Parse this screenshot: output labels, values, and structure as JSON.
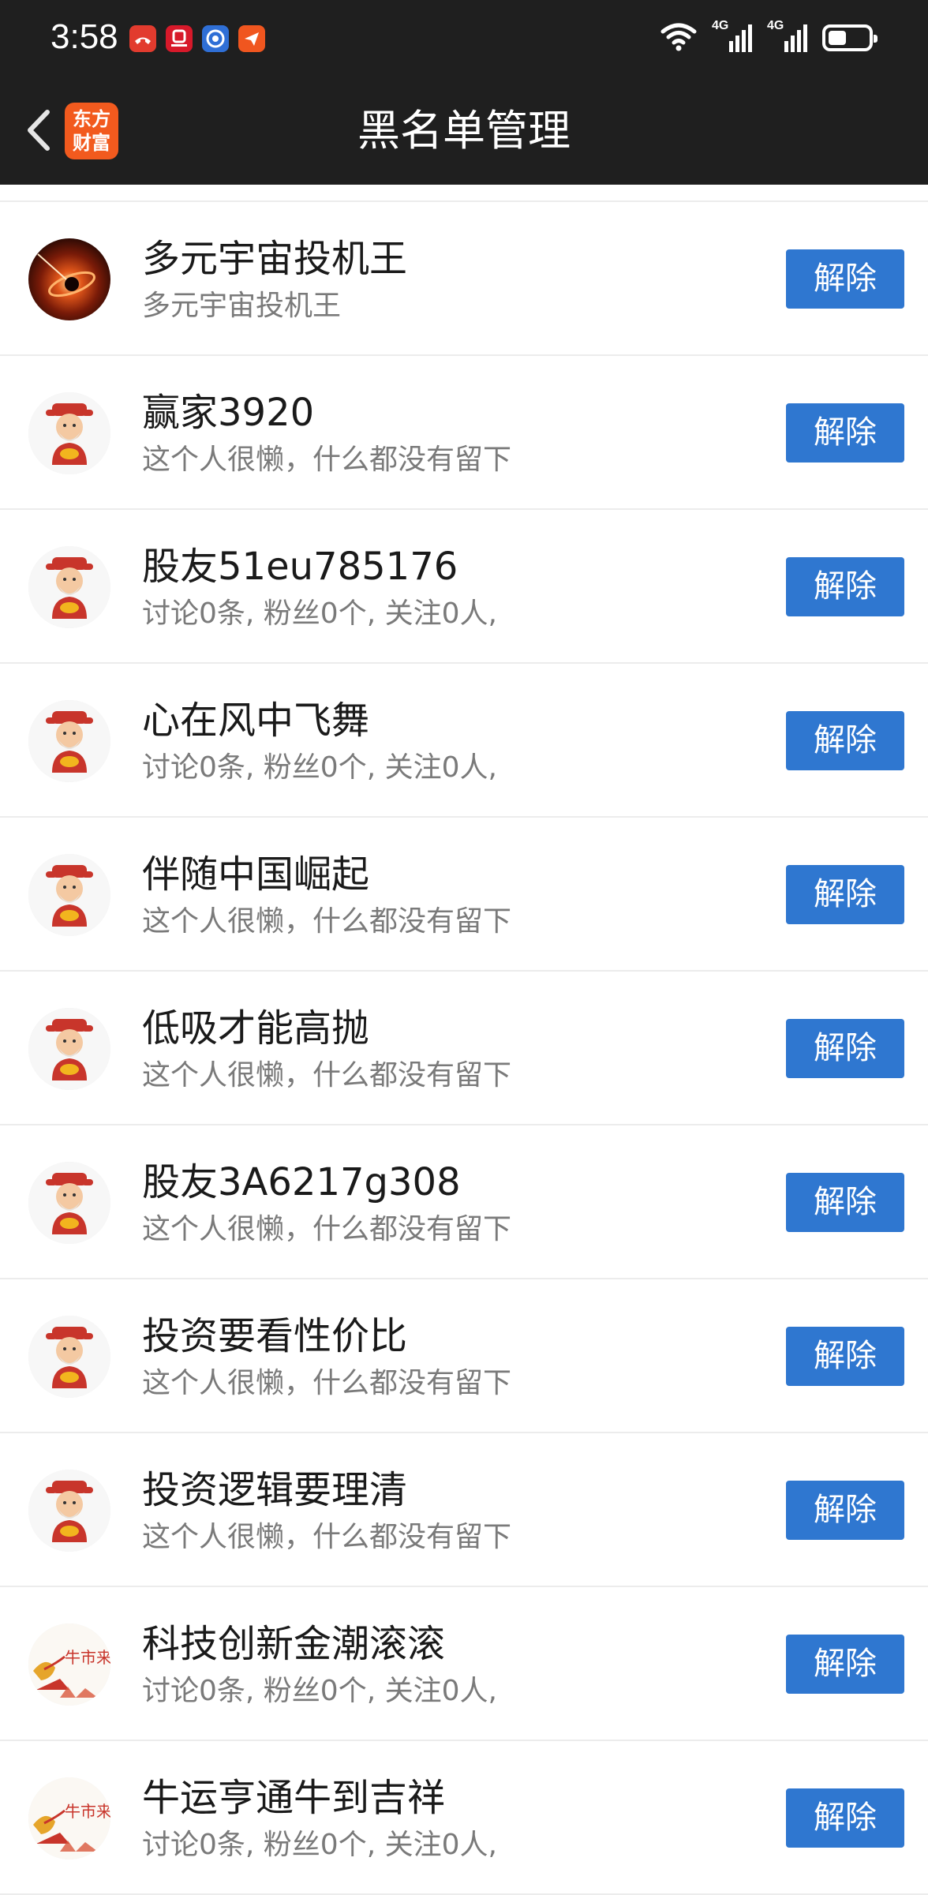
{
  "status_bar": {
    "time": "3:58",
    "network_1": "4G",
    "network_2": "4G",
    "battery_level": 0.45,
    "notification_icons": [
      "missed-call-icon",
      "securities-app-icon",
      "browser-app-icon",
      "messenger-app-icon"
    ]
  },
  "nav": {
    "title": "黑名单管理",
    "logo_line1": "东方",
    "logo_line2": "财富"
  },
  "colors": {
    "header_bg": "#1f1f1f",
    "button_bg": "#2f77d0",
    "logo_bg": "#f25a1e"
  },
  "list": {
    "button_label": "解除",
    "items": [
      {
        "name": "多元宇宙投机王",
        "subtitle": "多元宇宙投机王",
        "avatar": "galaxy-avatar"
      },
      {
        "name": "赢家3920",
        "subtitle": "这个人很懒，什么都没有留下",
        "avatar": "fortune-god-avatar"
      },
      {
        "name": "股友51eu785176",
        "subtitle": "讨论0条, 粉丝0个, 关注0人,",
        "avatar": "fortune-god-avatar"
      },
      {
        "name": "心在风中飞舞",
        "subtitle": "讨论0条, 粉丝0个, 关注0人,",
        "avatar": "fortune-god-avatar"
      },
      {
        "name": "伴随中国崛起",
        "subtitle": "这个人很懒，什么都没有留下",
        "avatar": "fortune-god-avatar"
      },
      {
        "name": "低吸才能高抛",
        "subtitle": "这个人很懒，什么都没有留下",
        "avatar": "fortune-god-avatar"
      },
      {
        "name": "股友3A6217g308",
        "subtitle": "这个人很懒，什么都没有留下",
        "avatar": "fortune-god-avatar"
      },
      {
        "name": "投资要看性价比",
        "subtitle": "这个人很懒，什么都没有留下",
        "avatar": "fortune-god-avatar"
      },
      {
        "name": "投资逻辑要理清",
        "subtitle": "这个人很懒，什么都没有留下",
        "avatar": "fortune-god-avatar"
      },
      {
        "name": "科技创新金潮滚滚",
        "subtitle": "讨论0条, 粉丝0个, 关注0人,",
        "avatar": "bull-market-avatar",
        "avatar_text": "牛市来"
      },
      {
        "name": "牛运亨通牛到吉祥",
        "subtitle": "讨论0条, 粉丝0个, 关注0人,",
        "avatar": "bull-market-avatar",
        "avatar_text": "牛市来"
      }
    ]
  }
}
